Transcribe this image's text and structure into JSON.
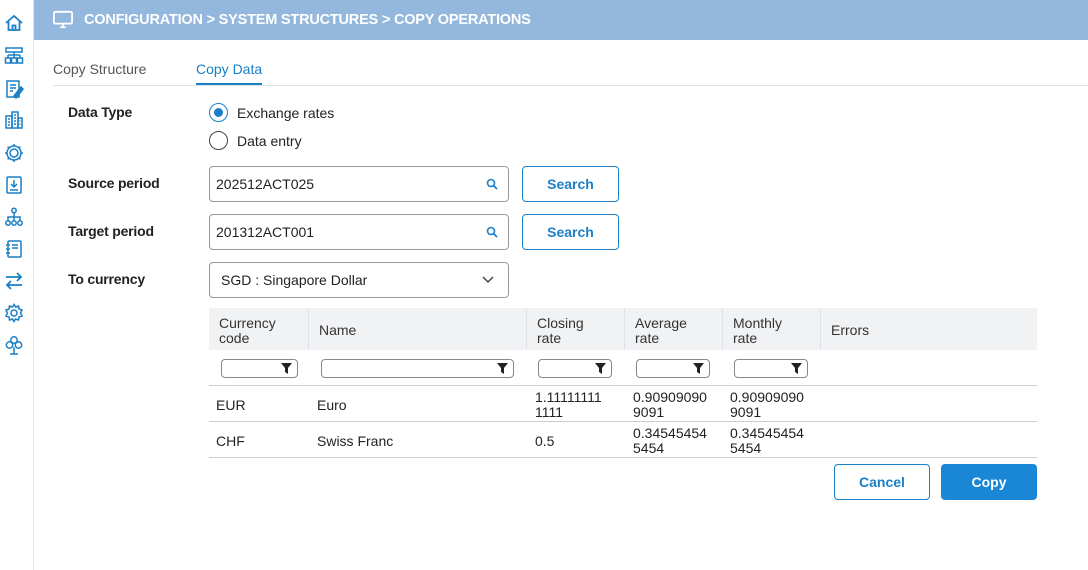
{
  "sidebar": {
    "icons": [
      "home-icon",
      "structure-icon",
      "edit-document-icon",
      "buildings-icon",
      "world-gear-icon",
      "download-document-icon",
      "hierarchy-icon",
      "notebook-icon",
      "transfer-arrows-icon",
      "settings-gear-icon",
      "flower-icon"
    ],
    "accent_color": "#1a7fc7"
  },
  "header": {
    "title": "CONFIGURATION > SYSTEM STRUCTURES > COPY OPERATIONS",
    "icon": "monitor-icon",
    "background_color": "#94b8dd"
  },
  "tabs": [
    {
      "label": "Copy Structure",
      "active": false
    },
    {
      "label": "Copy Data",
      "active": true
    }
  ],
  "form": {
    "data_type_label": "Data Type",
    "data_type_options": [
      {
        "label": "Exchange rates",
        "selected": true
      },
      {
        "label": "Data entry",
        "selected": false
      }
    ],
    "source_period_label": "Source period",
    "source_period_value": "202512ACT025",
    "target_period_label": "Target period",
    "target_period_value": "201312ACT001",
    "search_button_label": "Search",
    "to_currency_label": "To currency",
    "to_currency_value": "SGD : Singapore Dollar"
  },
  "table": {
    "columns": [
      {
        "label_line1": "Currency",
        "label_line2": "code"
      },
      {
        "label_line1": "Name",
        "label_line2": ""
      },
      {
        "label_line1": "Closing",
        "label_line2": "rate"
      },
      {
        "label_line1": "Average",
        "label_line2": "rate"
      },
      {
        "label_line1": "Monthly",
        "label_line2": "rate"
      },
      {
        "label_line1": "Errors",
        "label_line2": ""
      }
    ],
    "rows": [
      {
        "currency_code": "EUR",
        "name": "Euro",
        "closing_rate_line1": "1.11111111",
        "closing_rate_line2": "1111",
        "average_rate_line1": "0.90909090",
        "average_rate_line2": "9091",
        "monthly_rate_line1": "0.90909090",
        "monthly_rate_line2": "9091",
        "errors": ""
      },
      {
        "currency_code": "CHF",
        "name": "Swiss Franc",
        "closing_rate_line1": "0.5",
        "closing_rate_line2": "",
        "average_rate_line1": "0.34545454",
        "average_rate_line2": "5454",
        "monthly_rate_line1": "0.34545454",
        "monthly_rate_line2": "5454",
        "errors": ""
      }
    ]
  },
  "actions": {
    "cancel_label": "Cancel",
    "copy_label": "Copy"
  }
}
